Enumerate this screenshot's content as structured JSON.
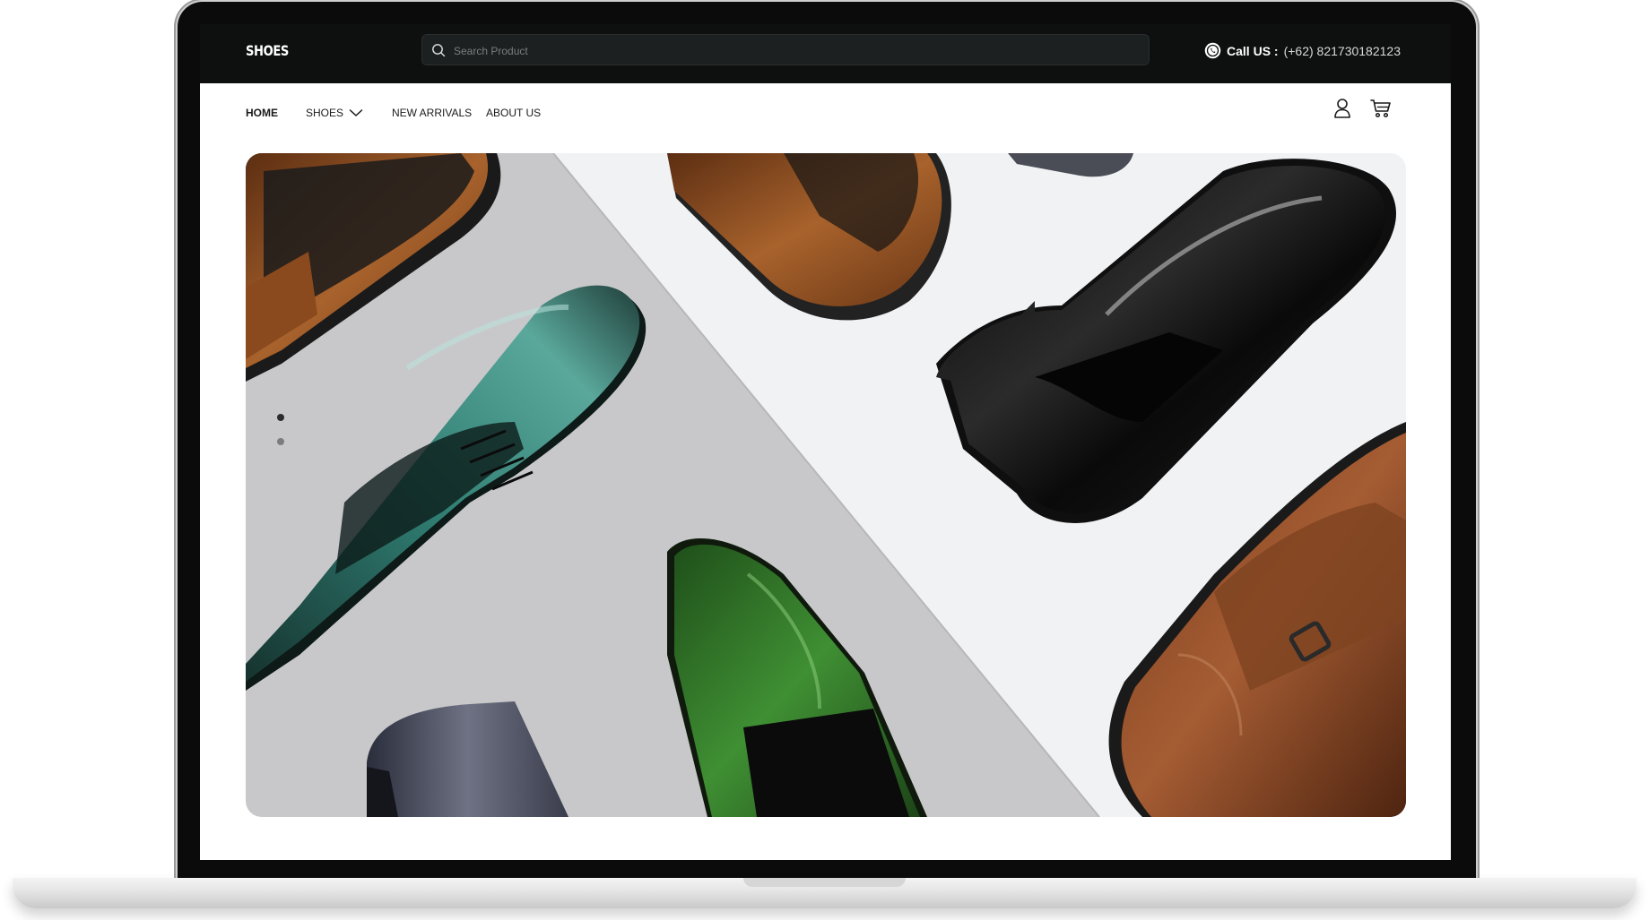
{
  "header": {
    "brand": "SHOES",
    "search_placeholder": "Search Product",
    "call_label": "Call US :",
    "call_number": "(+62) 821730182123"
  },
  "nav": {
    "items": [
      {
        "label": "HOME",
        "active": true
      },
      {
        "label": "SHOES",
        "has_dropdown": true
      },
      {
        "label": "NEW ARRIVALS"
      },
      {
        "label": "ABOUT US"
      }
    ],
    "icons": [
      "user-icon",
      "cart-icon"
    ]
  },
  "hero": {
    "image": "hero-shoes-banner",
    "slides": 2,
    "active_slide": 1
  },
  "colors": {
    "topbar": "#0e0f0f",
    "search_bg": "#1d2020",
    "page_bg": "#ffffff",
    "hero_left": "#c9c9cb",
    "hero_right": "#f1f2f4"
  }
}
